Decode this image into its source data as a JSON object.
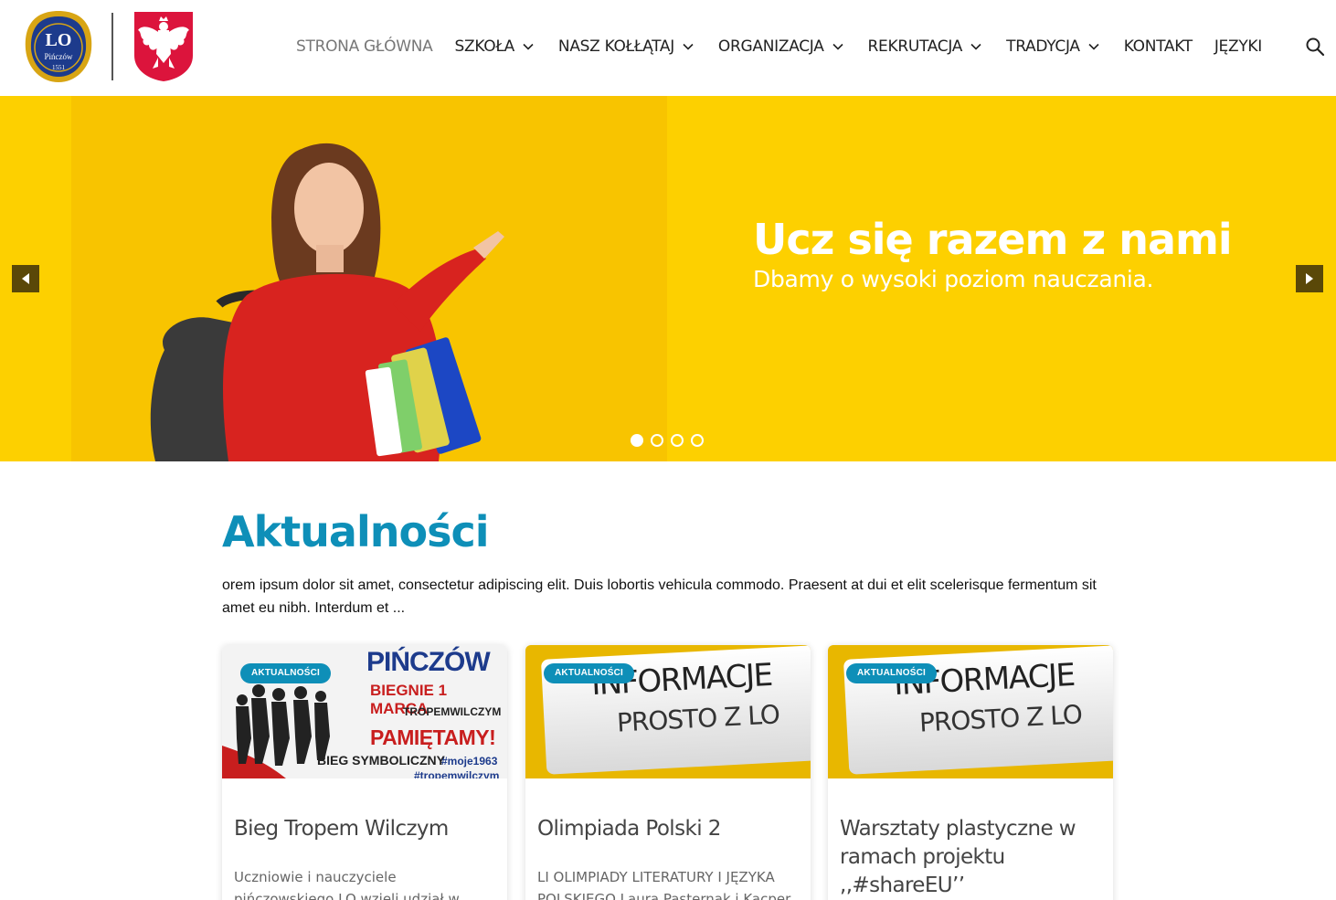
{
  "header": {
    "logo_text": "LO",
    "logo_city": "Pińczów",
    "logo_year": "1551",
    "nav": [
      {
        "label": "STRONA GŁÓWNA",
        "dropdown": false,
        "active": true
      },
      {
        "label": "SZKOŁA",
        "dropdown": true
      },
      {
        "label": "NASZ KOŁŁĄTAJ",
        "dropdown": true
      },
      {
        "label": "ORGANIZACJA",
        "dropdown": true
      },
      {
        "label": "REKRUTACJA",
        "dropdown": true
      },
      {
        "label": "TRADYCJA",
        "dropdown": true
      },
      {
        "label": "KONTAKT",
        "dropdown": false
      },
      {
        "label": "JĘZYKI",
        "dropdown": false
      }
    ]
  },
  "hero": {
    "title": "Ucz się razem z nami",
    "subtitle": "Dbamy o wysoki poziom nauczania.",
    "slide_count": 4,
    "active_slide": 1,
    "bg_color": "#fdd000"
  },
  "section": {
    "title": "Aktualności",
    "intro": "orem ipsum dolor sit amet, consectetur adipiscing elit. Duis lobortis vehicula commodo. Praesent at dui et elit scelerisque fermentum sit amet eu nibh. Interdum et ..."
  },
  "poster1": {
    "l1": "PIŃCZÓW",
    "l2": "BIEGNIE 1 MARCA",
    "l3": "TROPEMWILCZYM",
    "l4": "PAMIĘTAMY!",
    "l5": "BIEG SYMBOLICZNY",
    "l6": "#moje1963",
    "l7": "#tropemwilczym"
  },
  "poster2": {
    "l1": "INFORMACJE",
    "l2": "PROSTO Z LO"
  },
  "cards": [
    {
      "badge": "AKTUALNOŚCI",
      "title": "Bieg Tropem Wilczym",
      "excerpt": "Uczniowie i nauczyciele pińczowskiego LO wzięli udział w ogólnopolskim"
    },
    {
      "badge": "AKTUALNOŚCI",
      "title": "Olimpiada Polski 2",
      "excerpt": "LI OLIMPIADY LITERATURY I JĘZYKA POLSKIEGO Laura Pasternak i Kacper"
    },
    {
      "badge": "AKTUALNOŚCI",
      "title": "Warsztaty plastyczne w ramach projektu ,,#shareEU’’",
      "excerpt": ""
    }
  ],
  "colors": {
    "accent": "#0e8fb8",
    "hero_yellow": "#fdd000",
    "arrow_bg": "#5a4808"
  }
}
